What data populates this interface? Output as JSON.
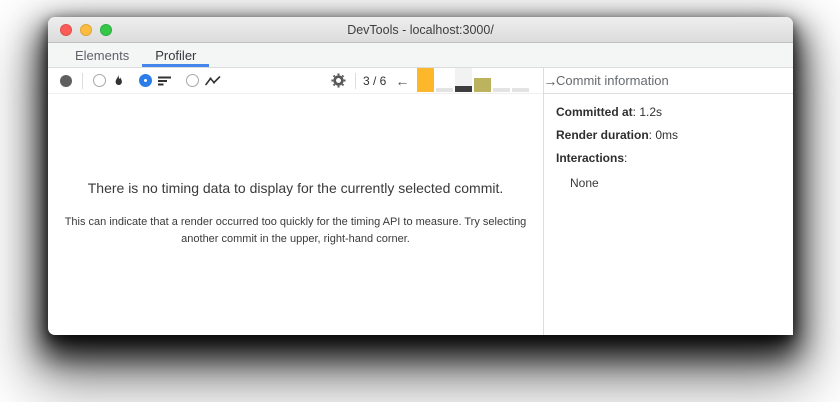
{
  "window": {
    "title": "DevTools - localhost:3000/",
    "traffic_lights": [
      {
        "name": "close-button",
        "color": "#fc5b57"
      },
      {
        "name": "minimize-button",
        "color": "#fdbc40"
      },
      {
        "name": "maximize-button",
        "color": "#34c749"
      }
    ]
  },
  "tabs": [
    {
      "label": "Elements",
      "active": false
    },
    {
      "label": "Profiler",
      "active": true
    }
  ],
  "toolbar": {
    "record_icon": "record-dot-icon",
    "view_options": [
      {
        "icon": "flame-icon",
        "selected": false
      },
      {
        "icon": "ranked-icon",
        "selected": true
      },
      {
        "icon": "interactions-icon",
        "selected": false
      }
    ],
    "settings_icon": "gear-icon",
    "commit_selector": {
      "position": "3 / 6",
      "prev_arrow": "←",
      "next_arrow": "→",
      "bars": [
        {
          "color": "#fcb72a",
          "height_pct": 100,
          "selected": false
        },
        {
          "color": "#e3e3e3",
          "height_pct": 18,
          "selected": false
        },
        {
          "color": "#3d3d3f",
          "height_pct": 26,
          "selected": true
        },
        {
          "color": "#bcb35f",
          "height_pct": 57,
          "selected": false
        },
        {
          "color": "#e3e3e3",
          "height_pct": 18,
          "selected": false
        },
        {
          "color": "#e3e3e3",
          "height_pct": 18,
          "selected": false
        }
      ]
    }
  },
  "main": {
    "empty_title": "There is no timing data to display for the currently selected commit.",
    "empty_description": "This can indicate that a render occurred too quickly for the timing API to measure. Try selecting another commit in the upper, right-hand corner."
  },
  "sidebar": {
    "header": "Commit information",
    "fields": [
      {
        "label": "Committed at",
        "separator": ": ",
        "value": "1.2s"
      },
      {
        "label": "Render duration",
        "separator": ": ",
        "value": "0ms"
      },
      {
        "label": "Interactions",
        "separator": ":",
        "value": ""
      }
    ],
    "interactions_empty": "None"
  },
  "colors": {
    "tab_accent": "#4487ea",
    "radio_selected": "#2b7de9",
    "selected_bar_bg": "#f2f2f2"
  }
}
